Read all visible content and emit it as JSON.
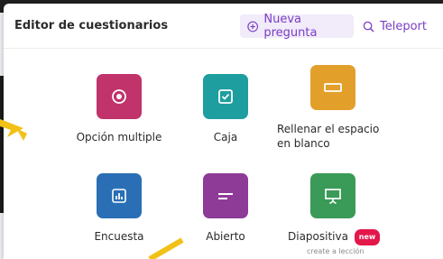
{
  "header": {
    "title": "Editor de cuestionarios",
    "new_question_label": "Nueva pregunta",
    "teleport_label": "Teleport"
  },
  "question_types": [
    {
      "label": "Opción multiple",
      "color": "#c0336b",
      "icon": "radio-icon"
    },
    {
      "label": "Caja",
      "color": "#1f9ea0",
      "icon": "checkbox-icon"
    },
    {
      "label": "Rellenar el espacio en blanco",
      "color": "#e2a02b",
      "icon": "blank-field-icon"
    },
    {
      "label": "Encuesta",
      "color": "#2a6fb5",
      "icon": "poll-chart-icon"
    },
    {
      "label": "Abierto",
      "color": "#8e3b97",
      "icon": "open-text-icon"
    },
    {
      "label": "Diapositiva",
      "color": "#3a9a57",
      "icon": "slide-presentation-icon",
      "badge": "new",
      "sub": "create a lección"
    }
  ],
  "colors": {
    "accent": "#7a3fc4",
    "accent_bg": "#f1ebfa",
    "badge": "#e4174a",
    "arrow": "#f2c118"
  }
}
